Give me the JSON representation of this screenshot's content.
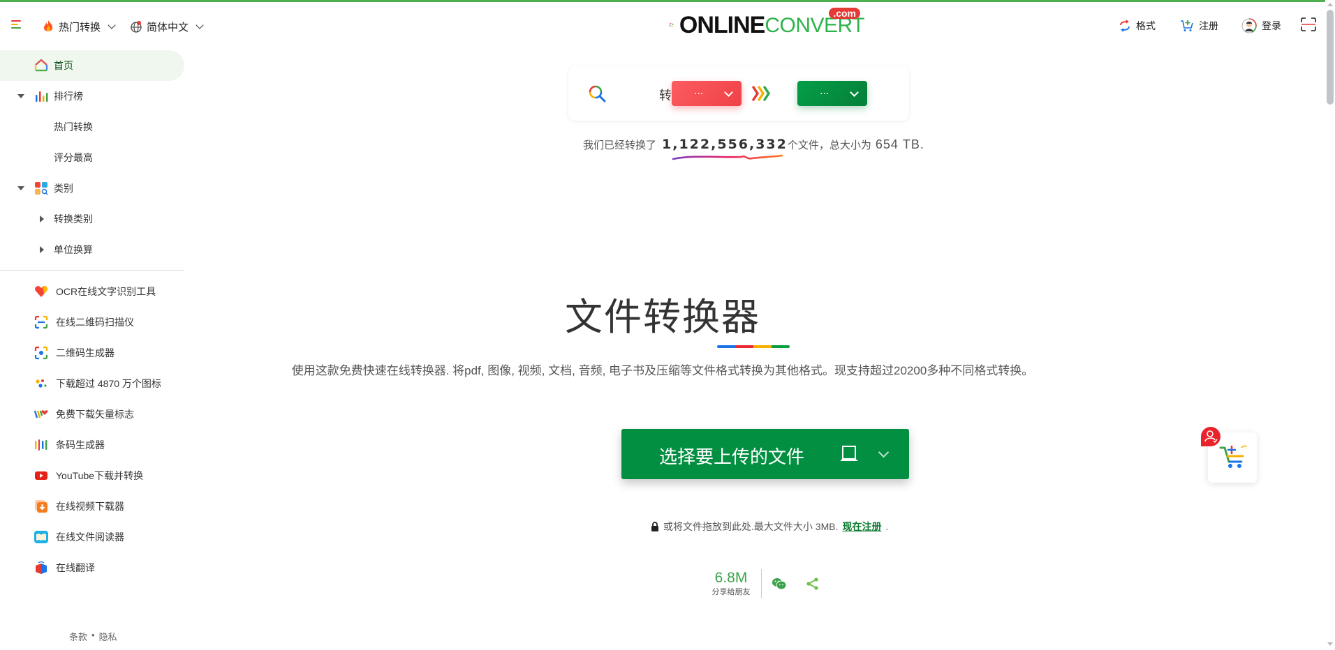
{
  "header": {
    "hot_label": "热门转换",
    "lang_label": "简体中文",
    "logo": {
      "part1": "ONLINE",
      "part2": "CONVERT",
      "tld": ".com"
    },
    "links": [
      {
        "label": "格式",
        "icon": "format-convert-icon"
      },
      {
        "label": "注册",
        "icon": "cart-add-icon"
      },
      {
        "label": "登录",
        "icon": "user-avatar-icon"
      }
    ],
    "scan_icon": "scan-icon"
  },
  "sidebar": {
    "home": "首页",
    "ranking": {
      "label": "排行榜",
      "children": [
        "热门转换",
        "评分最高"
      ]
    },
    "categories": {
      "label": "类别",
      "children": [
        "转换类别",
        "单位换算"
      ]
    },
    "tools": [
      {
        "label": "OCR在线文字识别工具",
        "icon": "heart-icon"
      },
      {
        "label": "在线二维码扫描仪",
        "icon": "qr-scan-icon"
      },
      {
        "label": "二维码生成器",
        "icon": "qr-generate-icon"
      },
      {
        "label": "下载超过 4870 万个图标",
        "icon": "dots-icon"
      },
      {
        "label": "免费下载矢量标志",
        "icon": "vector-logo-icon"
      },
      {
        "label": "条码生成器",
        "icon": "barcode-icon"
      },
      {
        "label": "YouTube下载并转换",
        "icon": "youtube-icon"
      },
      {
        "label": "在线视频下载器",
        "icon": "video-download-icon"
      },
      {
        "label": "在线文件阅读器",
        "icon": "book-icon"
      },
      {
        "label": "在线翻译",
        "icon": "translate-cube-icon"
      }
    ],
    "footer": {
      "terms": "条款",
      "sep": "•",
      "privacy": "隐私"
    }
  },
  "search": {
    "convert_label": "转换",
    "from_value": "...",
    "to_value": "..."
  },
  "stats": {
    "prefix": "我们已经转换了",
    "count": "1,122,556,332",
    "middle": "个文件，总大小为",
    "size": "654 TB."
  },
  "main": {
    "title": "文件转换器",
    "subtitle": "使用这款免费快速在线转换器. 将pdf, 图像, 视频, 文档, 音频, 电子书及压缩等文件格式转换为其他格式。现支持超过20200多种不同格式转换。",
    "upload_label": "选择要上传的文件",
    "drop_note": "或将文件拖放到此处.最大文件大小 3MB.",
    "register_link": "现在注册",
    "drop_note_end": "."
  },
  "share": {
    "count": "6.8M",
    "label": "分享给朋友"
  },
  "colors": {
    "brand_green": "#038f41",
    "from_red": "#f04147",
    "accent_blue": "#1a73e8",
    "accent_red": "#ea2a33",
    "accent_yellow": "#f6b000",
    "accent_green": "#0a9d44"
  }
}
